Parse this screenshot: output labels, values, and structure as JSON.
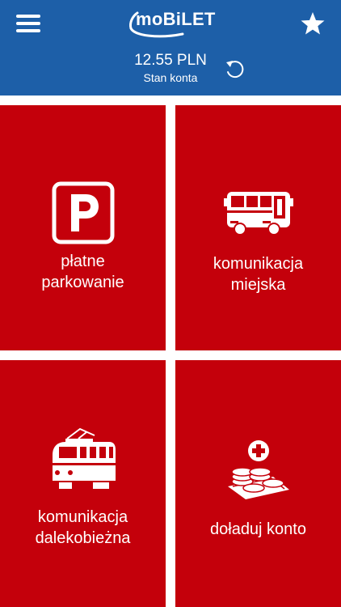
{
  "header": {
    "logo_text": "moBiLET",
    "balance_amount": "12.55 PLN",
    "balance_label": "Stan konta",
    "background_color": "#1d5fa8"
  },
  "icons": {
    "menu": "hamburger-menu-icon",
    "favorite": "star-icon",
    "refresh": "refresh-icon"
  },
  "tiles": [
    {
      "label": "płatne\nparkowanie",
      "icon": "parking-icon"
    },
    {
      "label": "komunikacja\nmiejska",
      "icon": "bus-icon"
    },
    {
      "label": "komunikacja\ndalekobieżna",
      "icon": "train-icon"
    },
    {
      "label": "doładuj konto",
      "icon": "top-up-coins-icon"
    }
  ],
  "tile_color": "#c4000b"
}
